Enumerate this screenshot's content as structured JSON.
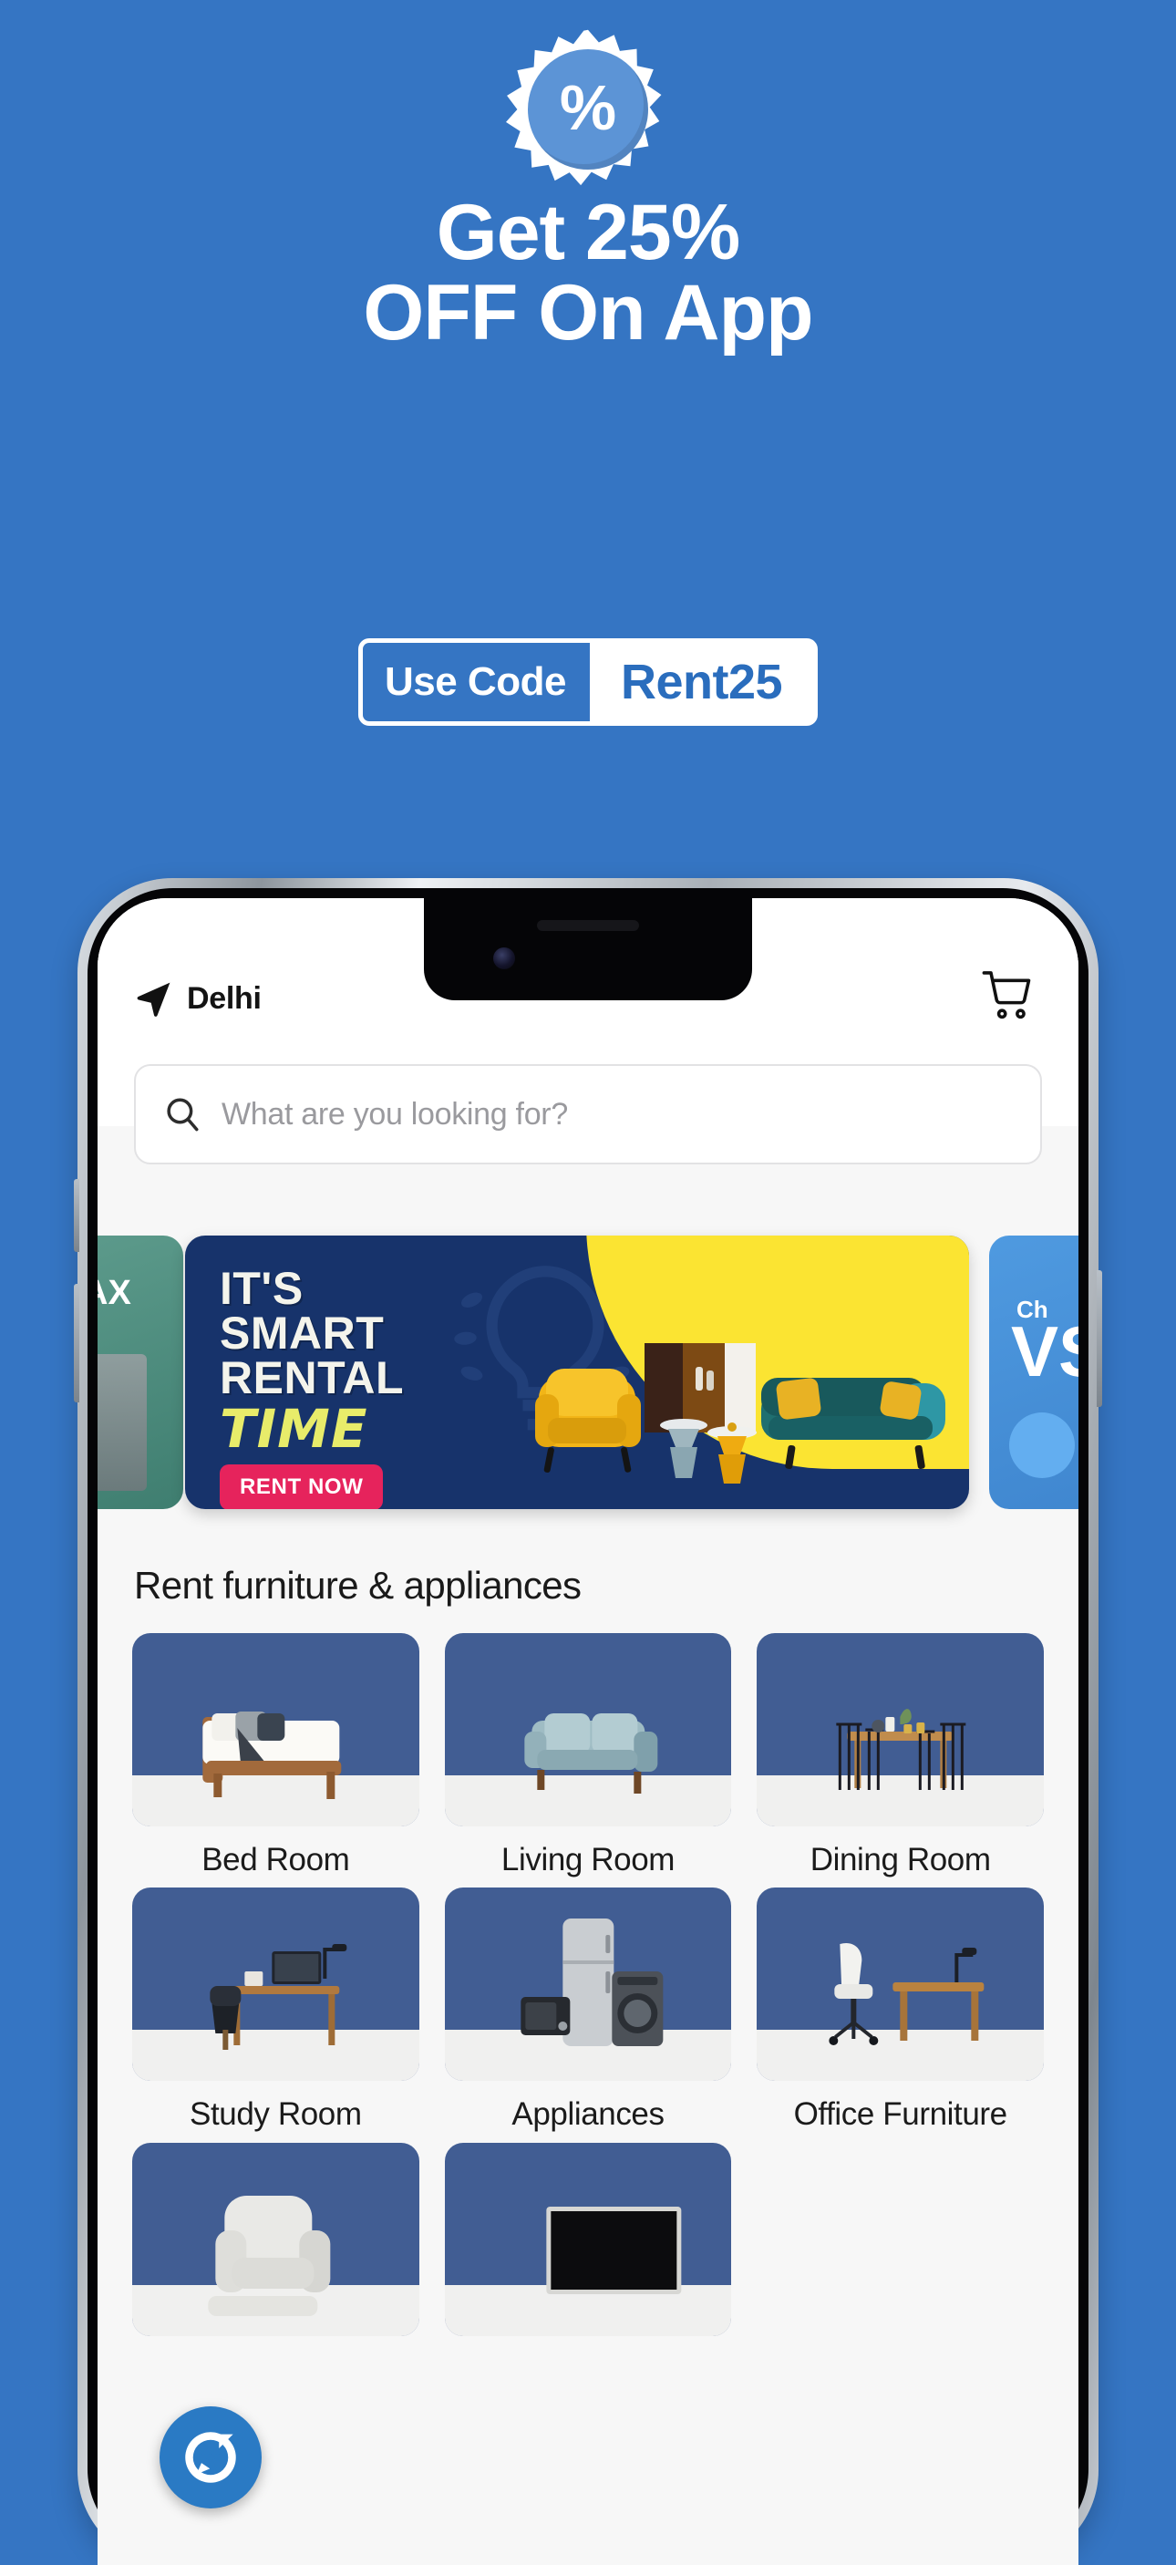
{
  "promo": {
    "badge_symbol": "%",
    "headline_line1": "Get 25%",
    "headline_line2": "OFF On App",
    "use_code_label": "Use Code",
    "code": "Rent25",
    "background_color": "#3575c3",
    "code_text_color": "#2a6dbd"
  },
  "app": {
    "header": {
      "location": "Delhi",
      "location_icon": "navigation-arrow-icon",
      "cart_icon": "shopping-cart-icon"
    },
    "search": {
      "placeholder": "What are you looking for?",
      "value": "",
      "icon": "search-icon"
    },
    "banners": {
      "prev_peek_text": "AX",
      "next_peek_line1": "Ch",
      "next_peek_line2": "VS",
      "main": {
        "line1": "IT'S",
        "line2": "SMART",
        "line3": "RENTAL",
        "script_word": "TIME",
        "cta": "RENT NOW",
        "bg_color": "#17336b",
        "accent_color": "#fbe432",
        "cta_color": "#e6235c"
      }
    },
    "section_title": "Rent furniture & appliances",
    "categories": [
      {
        "label": "Bed Room",
        "image": "bedroom-photo"
      },
      {
        "label": "Living Room",
        "image": "living-room-photo"
      },
      {
        "label": "Dining Room",
        "image": "dining-room-photo"
      },
      {
        "label": "Study Room",
        "image": "study-room-photo"
      },
      {
        "label": "Appliances",
        "image": "appliances-photo"
      },
      {
        "label": "Office Furniture",
        "image": "office-furniture-photo"
      },
      {
        "label": "",
        "image": "recliner-photo"
      },
      {
        "label": "",
        "image": "television-photo"
      }
    ],
    "chat_fab": {
      "icon": "chat-bubble-icon"
    }
  }
}
